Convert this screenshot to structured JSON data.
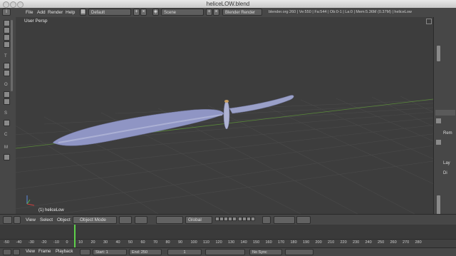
{
  "window": {
    "title": "heliceLOW.blend"
  },
  "info_header": {
    "menus": [
      "File",
      "Add",
      "Render",
      "Help"
    ],
    "screen_layout": "Default",
    "scene": "Scene",
    "render_engine": "Blender Render",
    "stats": "blender.org 260 | Ve:550 | Fa:544 | Ob:0-1 | La:0 | Mem:5.36M (0.37M) | heliceLow"
  },
  "left_toolbar": {
    "letters": [
      "T",
      "O",
      "S",
      "C",
      "M"
    ]
  },
  "viewport": {
    "view_label": "User Persp",
    "object_label": "(1) heliceLow"
  },
  "right_panel": {
    "labels": [
      "Rem",
      "Lay",
      "Di"
    ]
  },
  "view_header": {
    "menus": [
      "View",
      "Select",
      "Object"
    ],
    "mode": "Object Mode",
    "orientation": "Global"
  },
  "timeline": {
    "ticks": [
      "-50",
      "-40",
      "-30",
      "-20",
      "-10",
      "0",
      "10",
      "20",
      "30",
      "40",
      "50",
      "60",
      "70",
      "80",
      "90",
      "100",
      "110",
      "120",
      "130",
      "140",
      "150",
      "160",
      "170",
      "180",
      "190",
      "200",
      "210",
      "220",
      "230",
      "240",
      "250",
      "260",
      "270",
      "280"
    ],
    "current_frame": 1,
    "colors": {
      "playhead": "#5ed14a",
      "background": "#414141"
    }
  },
  "timeline_header": {
    "menus": [
      "View",
      "Frame",
      "Playback"
    ],
    "start": "Start: 1",
    "end": "End: 250",
    "current": "1",
    "sync": "No Sync"
  },
  "colors": {
    "viewport_bg": "#3d3d3d",
    "panel_bg": "#474747",
    "mesh": "#9aa0c8"
  }
}
